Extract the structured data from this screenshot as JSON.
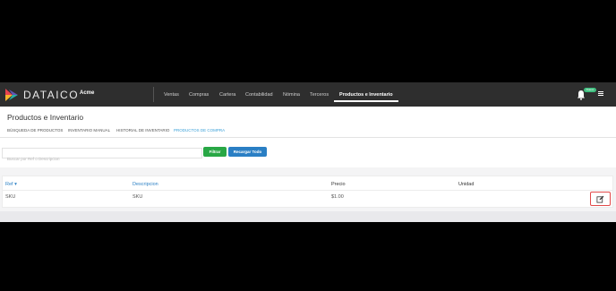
{
  "app": {
    "brand": "DATAICO",
    "company": "Acme",
    "logo_colors": [
      "#e8434f",
      "#f7b52c",
      "#27b0a6",
      "#6a5acd"
    ]
  },
  "nav": {
    "items": [
      {
        "label": "Ventas"
      },
      {
        "label": "Compras"
      },
      {
        "label": "Cartera"
      },
      {
        "label": "Contabilidad"
      },
      {
        "label": "Nómina"
      },
      {
        "label": "Terceros"
      },
      {
        "label": "Productos e Inventario",
        "active": true
      }
    ],
    "badge": "Nuevo",
    "icons": [
      "bell-icon",
      "hamburger-menu-icon"
    ]
  },
  "page": {
    "title": "Productos e Inventario",
    "tabs": [
      {
        "label": "BÚSQUEDA DE PRODUCTOS"
      },
      {
        "label": "INVENTARIO MANUAL"
      },
      {
        "label": "HISTORIAL DE INVENTARIO"
      },
      {
        "label": "PRODUCTOS DE COMPRA",
        "active": true
      }
    ]
  },
  "filters": {
    "search_placeholder": "Buscar por Ref o Descripcion",
    "search_value": "",
    "filter_label": "Filtrar",
    "reload_label": "Recargar Todo"
  },
  "table": {
    "columns": [
      "Ref",
      "Descripcion",
      "Precio",
      "Unidad"
    ],
    "sort_indicator": "▾",
    "rows": [
      {
        "ref": "SKU",
        "descripcion": "SKU",
        "precio": "$1.00",
        "unidad": ""
      }
    ],
    "row_action_icon": "edit-icon"
  },
  "colors": {
    "topbar": "#2e2e2e",
    "active_tab": "#3aa0d8",
    "filter_button": "#28a745",
    "reload_button": "#2a7fc4",
    "edit_border": "#e24a4a",
    "badge": "#3fbf7f"
  }
}
